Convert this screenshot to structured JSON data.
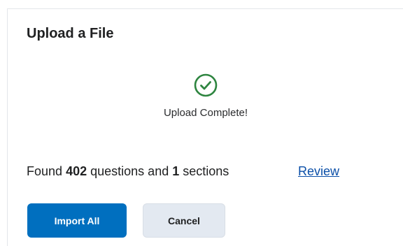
{
  "dialog": {
    "title": "Upload a File",
    "status": {
      "icon": "check-circle-icon",
      "icon_color": "#2e8540",
      "text": "Upload Complete!"
    },
    "summary": {
      "prefix": "Found",
      "question_count": "402",
      "middle": "questions and",
      "section_count": "1",
      "suffix": "sections"
    },
    "review_link": "Review",
    "buttons": {
      "import_all": "Import All",
      "cancel": "Cancel"
    },
    "colors": {
      "primary": "#006fbf",
      "link": "#0b4fa8",
      "secondary_bg": "#e3e9f1"
    }
  }
}
